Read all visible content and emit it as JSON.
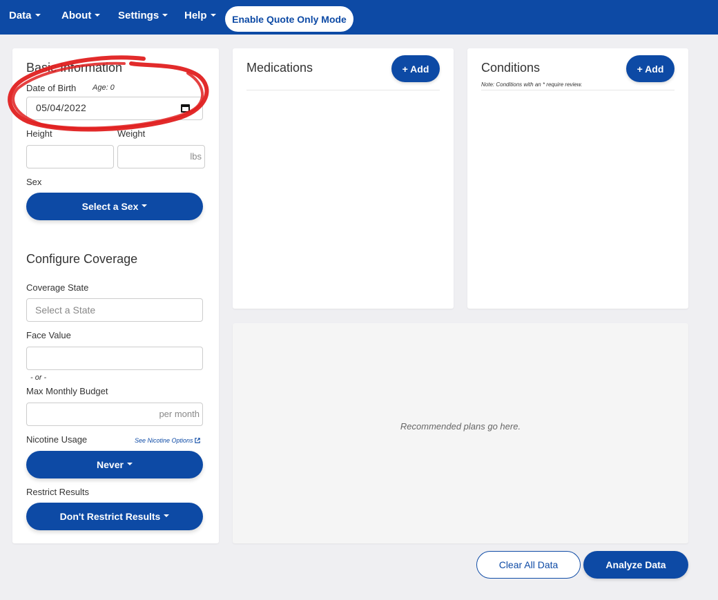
{
  "nav": {
    "items": [
      {
        "label": "Data"
      },
      {
        "label": "About"
      },
      {
        "label": "Settings"
      },
      {
        "label": "Help"
      }
    ],
    "quote_mode_label": "Enable Quote Only Mode"
  },
  "basic_info": {
    "title": "Basic Information",
    "dob_label": "Date of Birth",
    "age_label": "Age: 0",
    "dob_value": "05/04/2022",
    "height_label": "Height",
    "weight_label": "Weight",
    "weight_suffix": "lbs",
    "sex_label": "Sex",
    "sex_button": "Select a Sex"
  },
  "coverage": {
    "title": "Configure Coverage",
    "state_label": "Coverage State",
    "state_placeholder": "Select a State",
    "face_value_label": "Face Value",
    "or_text": "- or -",
    "budget_label": "Max Monthly Budget",
    "budget_suffix": "per month",
    "nicotine_label": "Nicotine Usage",
    "nicotine_link": "See Nicotine Options",
    "nicotine_button": "Never",
    "restrict_label": "Restrict Results",
    "restrict_button": "Don't Restrict Results"
  },
  "medications": {
    "title": "Medications",
    "add_label": "+ Add"
  },
  "conditions": {
    "title": "Conditions",
    "add_label": "+ Add",
    "note": "Note: Conditions with an * require review."
  },
  "plans": {
    "placeholder": "Recommended plans go here."
  },
  "actions": {
    "clear_label": "Clear All Data",
    "analyze_label": "Analyze Data"
  },
  "colors": {
    "primary": "#0d4aa5",
    "annotation": "#e02020",
    "background": "#efeff2"
  }
}
